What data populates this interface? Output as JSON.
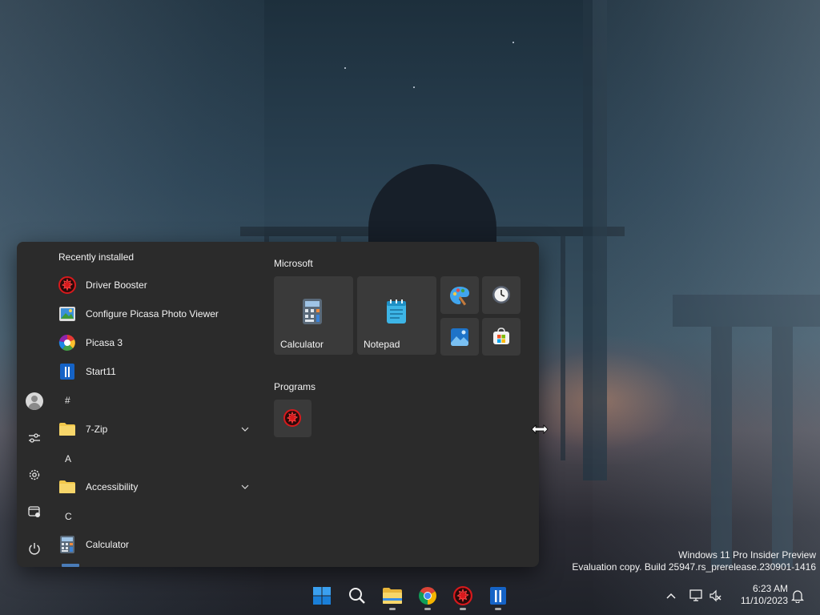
{
  "start_menu": {
    "recently_installed_title": "Recently installed",
    "recent_apps": [
      {
        "label": "Driver Booster",
        "icon": "driver-booster-icon"
      },
      {
        "label": "Configure Picasa Photo Viewer",
        "icon": "picasa-viewer-icon"
      },
      {
        "label": "Picasa 3",
        "icon": "picasa-icon"
      },
      {
        "label": "Start11",
        "icon": "start11-icon"
      }
    ],
    "letter_hash": "#",
    "folder_7zip": "7-Zip",
    "letter_a": "A",
    "folder_accessibility": "Accessibility",
    "letter_c": "C",
    "app_calculator": "Calculator",
    "rail": [
      "user-avatar",
      "personalization-icon",
      "settings-icon",
      "file-explorer-icon",
      "power-icon"
    ]
  },
  "pinned": {
    "microsoft_title": "Microsoft",
    "tiles": [
      {
        "label": "Calculator",
        "icon": "calculator-icon"
      },
      {
        "label": "Notepad",
        "icon": "notepad-icon"
      }
    ],
    "small_tiles": [
      "paint-icon",
      "clock-icon",
      "photos-icon",
      "store-icon"
    ],
    "programs_title": "Programs",
    "programs": [
      "driver-booster-icon"
    ]
  },
  "watermark": {
    "line1": "Windows 11 Pro Insider Preview",
    "line2": "Evaluation copy. Build 25947.rs_prerelease.230901-1416"
  },
  "taskbar": {
    "apps": [
      "start-icon",
      "search-icon",
      "file-explorer-icon",
      "chrome-icon",
      "driver-booster-icon",
      "start11-icon"
    ],
    "time": "6:23 AM",
    "date": "11/10/2023"
  },
  "colors": {
    "menu_bg": "#2b2b2b",
    "tile_bg": "#3a3a3a",
    "accent_blue": "#0a74d6",
    "driver_booster_red": "#d8191c",
    "folder_yellow": "#f2c84b"
  }
}
